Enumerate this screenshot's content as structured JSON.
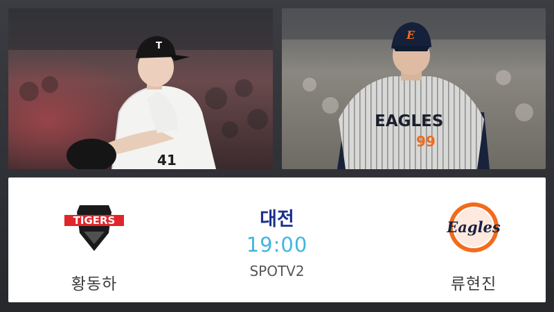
{
  "matchup": {
    "venue": "대전",
    "time": "19:00",
    "broadcast": "SPOTV2"
  },
  "home_team": {
    "logo_text": "TIGERS",
    "starting_pitcher": "황동하",
    "jersey_number": "41",
    "cap_letter": "T"
  },
  "away_team": {
    "logo_text": "Eagles",
    "starting_pitcher": "류현진",
    "jersey_text": "EAGLES",
    "jersey_number": "99",
    "cap_letter": "E"
  },
  "colors": {
    "venue": "#1a2f8a",
    "time": "#3fb6e0",
    "tigers_red": "#e0262b",
    "eagles_orange": "#f26b1d"
  }
}
